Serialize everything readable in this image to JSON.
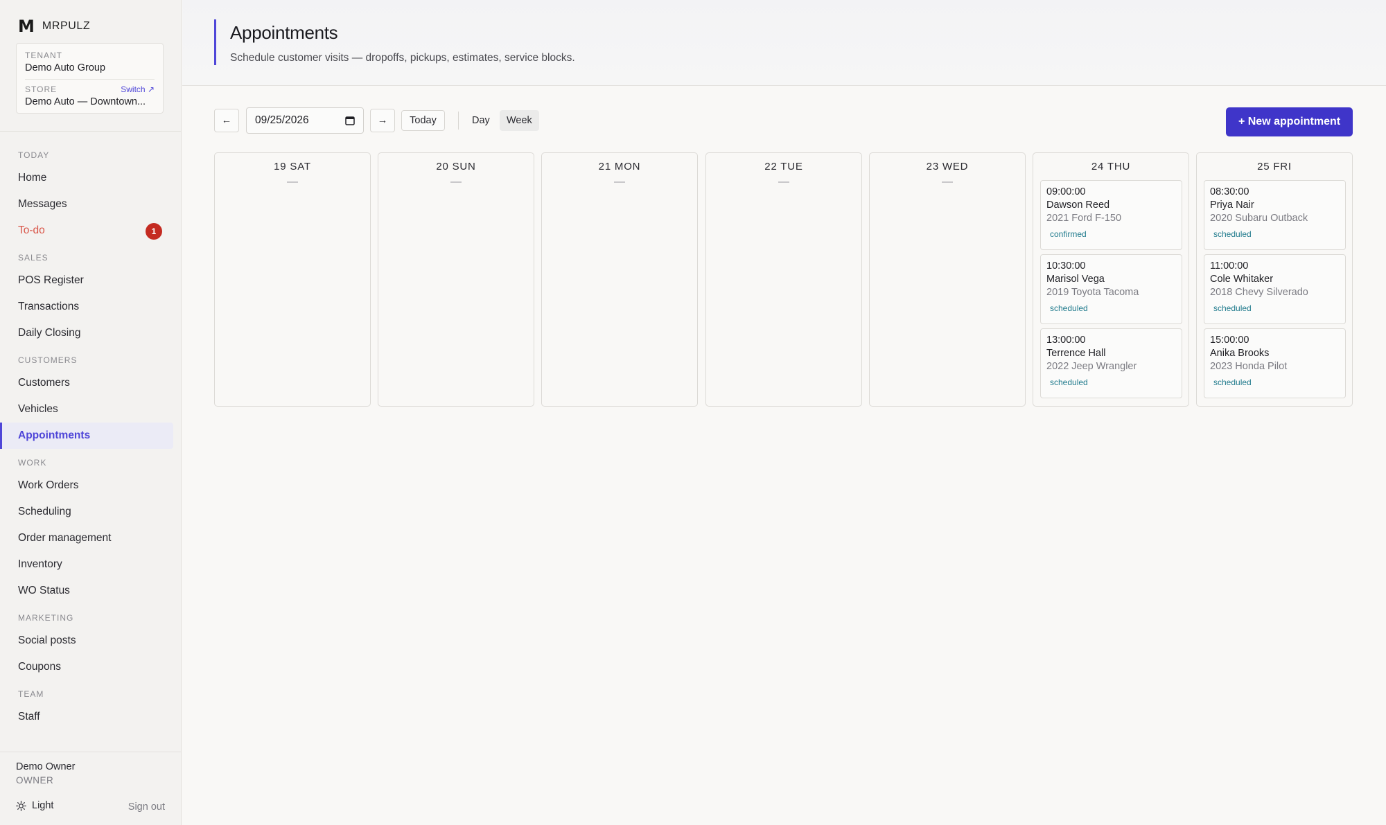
{
  "brand": {
    "logo": "M",
    "name": "MRPULZ"
  },
  "tenant_card": {
    "tenant_label": "TENANT",
    "tenant_value": "Demo Auto Group",
    "store_label": "STORE",
    "switch_label": "Switch ↗",
    "store_value": "Demo Auto — Downtown..."
  },
  "nav": {
    "today": "TODAY",
    "home": "Home",
    "messages": "Messages",
    "todo": "To-do",
    "todo_badge": "1",
    "sales": "SALES",
    "pos": "POS Register",
    "transactions": "Transactions",
    "daily_closing": "Daily Closing",
    "customers_section": "CUSTOMERS",
    "customers": "Customers",
    "vehicles": "Vehicles",
    "appointments": "Appointments",
    "work": "WORK",
    "work_orders": "Work Orders",
    "scheduling": "Scheduling",
    "order_management": "Order management",
    "inventory": "Inventory",
    "wo_status": "WO Status",
    "marketing": "MARKETING",
    "social_posts": "Social posts",
    "coupons": "Coupons",
    "team": "TEAM",
    "staff": "Staff"
  },
  "footer": {
    "user_name": "Demo Owner",
    "user_role": "OWNER",
    "theme_label": "Light",
    "sign_out": "Sign out"
  },
  "header": {
    "title": "Appointments",
    "subtitle": "Schedule customer visits — dropoffs, pickups, estimates, service blocks."
  },
  "toolbar": {
    "prev_icon": "←",
    "next_icon": "→",
    "date_value": "09/25/2026",
    "today_label": "Today",
    "day_label": "Day",
    "week_label": "Week",
    "new_appointment": "+ New appointment"
  },
  "week": {
    "empty_marker": "—",
    "days": [
      {
        "label": "19 SAT",
        "appointments": []
      },
      {
        "label": "20 SUN",
        "appointments": []
      },
      {
        "label": "21 MON",
        "appointments": []
      },
      {
        "label": "22 TUE",
        "appointments": []
      },
      {
        "label": "23 WED",
        "appointments": []
      },
      {
        "label": "24 THU",
        "appointments": [
          {
            "time": "09:00:00",
            "name": "Dawson Reed",
            "vehicle": "2021 Ford F-150",
            "status": "confirmed"
          },
          {
            "time": "10:30:00",
            "name": "Marisol Vega",
            "vehicle": "2019 Toyota Tacoma",
            "status": "scheduled"
          },
          {
            "time": "13:00:00",
            "name": "Terrence Hall",
            "vehicle": "2022 Jeep Wrangler",
            "status": "scheduled"
          }
        ]
      },
      {
        "label": "25 FRI",
        "appointments": [
          {
            "time": "08:30:00",
            "name": "Priya Nair",
            "vehicle": "2020 Subaru Outback",
            "status": "scheduled"
          },
          {
            "time": "11:00:00",
            "name": "Cole Whitaker",
            "vehicle": "2018 Chevy Silverado",
            "status": "scheduled"
          },
          {
            "time": "15:00:00",
            "name": "Anika Brooks",
            "vehicle": "2023 Honda Pilot",
            "status": "scheduled"
          }
        ]
      }
    ]
  },
  "colors": {
    "accent": "#4f46d8",
    "primary_button": "#3f35c9",
    "alert": "#d9574a",
    "badge": "#c42b21",
    "status_text": "#1f7a8c"
  }
}
